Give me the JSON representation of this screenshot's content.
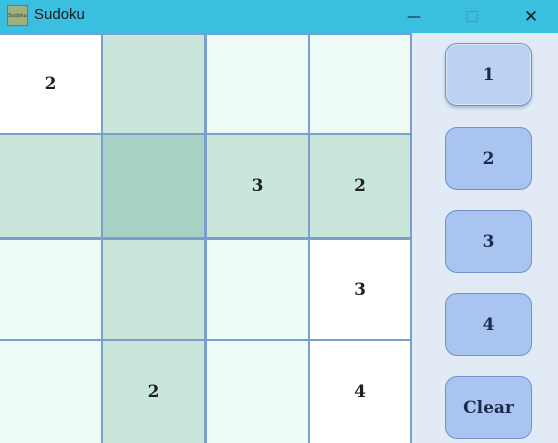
{
  "window": {
    "title": "Sudoku",
    "icon_text": "Sudoku",
    "minimize_glyph": "—",
    "maximize_glyph": "☐",
    "close_glyph": "✕"
  },
  "board": {
    "size": 4,
    "cells": [
      [
        "2",
        "",
        "",
        ""
      ],
      [
        "",
        "",
        "3",
        "2"
      ],
      [
        "",
        "",
        "",
        "3"
      ],
      [
        "",
        "2",
        "",
        "4"
      ]
    ]
  },
  "buttons": [
    {
      "label": "1",
      "selected": true
    },
    {
      "label": "2",
      "selected": false
    },
    {
      "label": "3",
      "selected": false
    },
    {
      "label": "4",
      "selected": false
    },
    {
      "label": "Clear",
      "selected": false
    }
  ],
  "colors": {
    "titlebar": "#3bbfe0",
    "cell_white": "#ffffff",
    "cell_light": "#eefaf6",
    "cell_highlight": "#cae6db",
    "cell_selected": "#a6d1c3",
    "button_fill": "#a9c4f0"
  }
}
